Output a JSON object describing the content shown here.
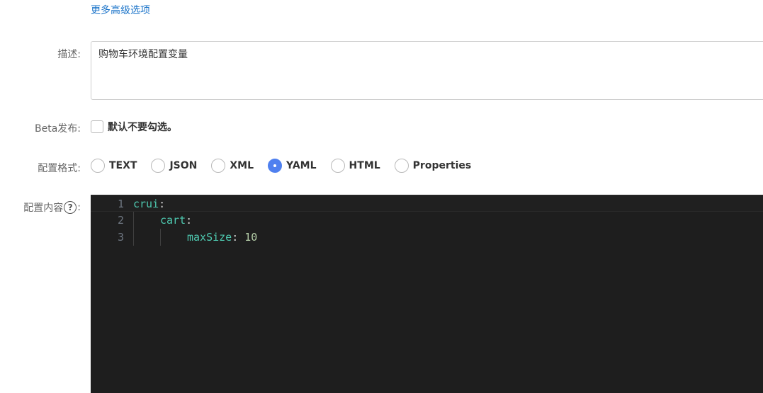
{
  "advanced_link": "更多高级选项",
  "description": {
    "label": "描述:",
    "value": "购物车环境配置变量"
  },
  "beta": {
    "label": "Beta发布:",
    "checkbox_text": "默认不要勾选。",
    "checked": false
  },
  "format": {
    "label": "配置格式:",
    "options": [
      "TEXT",
      "JSON",
      "XML",
      "YAML",
      "HTML",
      "Properties"
    ],
    "selected": "YAML"
  },
  "content": {
    "label": "配置内容",
    "help_icon": "question-circle-icon",
    "help_glyph": "?",
    "lines": [
      {
        "number": "1",
        "key": "crui",
        "sep": ":",
        "value": ""
      },
      {
        "number": "2",
        "key": "cart",
        "sep": ":",
        "value": ""
      },
      {
        "number": "3",
        "key": "maxSize",
        "sep": ": ",
        "value": "10"
      }
    ],
    "label_suffix": ":"
  },
  "colors": {
    "link": "#1a73c9",
    "radio_selected": "#4f80ef",
    "editor_bg": "#1e1e1e",
    "yaml_key": "#4ec9b0",
    "yaml_number": "#b5cea8"
  }
}
